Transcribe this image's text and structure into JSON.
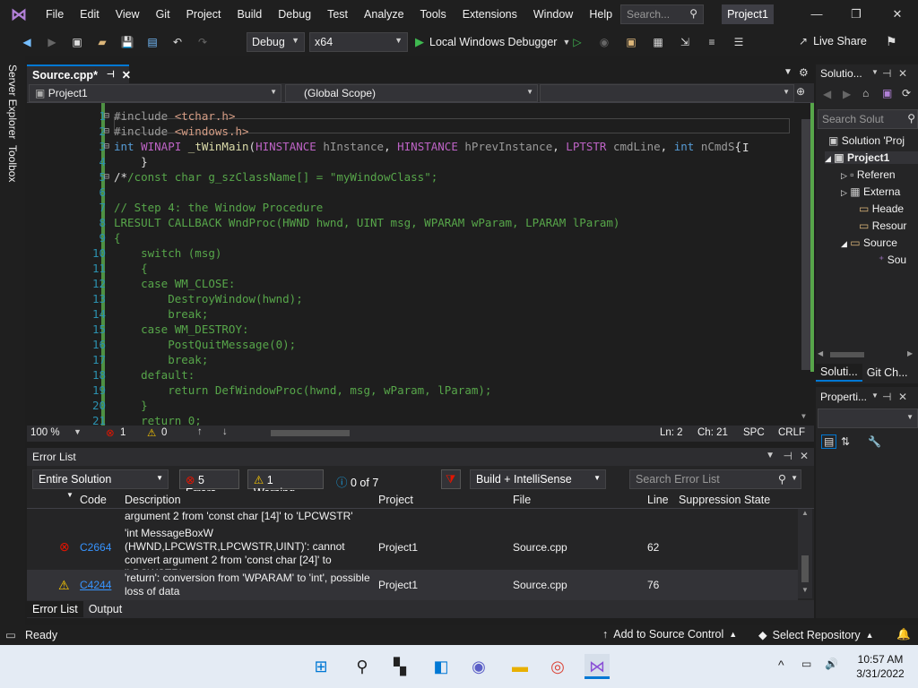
{
  "menu": {
    "items": [
      "File",
      "Edit",
      "View",
      "Git",
      "Project",
      "Build",
      "Debug",
      "Test",
      "Analyze",
      "Tools",
      "Extensions",
      "Window",
      "Help"
    ],
    "search_placeholder": "Search...",
    "project_name": "Project1"
  },
  "toolbar": {
    "config": "Debug",
    "platform": "x64",
    "run_label": "Local Windows Debugger",
    "live_share": "Live Share"
  },
  "side_tabs": {
    "server_explorer": "Server Explorer",
    "toolbox": "Toolbox"
  },
  "doc_tab": {
    "label": "Source.cpp*"
  },
  "nav": {
    "project": "Project1",
    "scope": "(Global Scope)"
  },
  "editor": {
    "line_numbers": [
      "1",
      "2",
      "3",
      "4",
      "5",
      "6",
      "7",
      "8",
      "9",
      "10",
      "11",
      "12",
      "13",
      "14",
      "15",
      "16",
      "17",
      "18",
      "19",
      "20",
      "21"
    ],
    "zoom": "100 %",
    "errors_count": "1",
    "warnings_count": "0",
    "ln": "Ln: 2",
    "ch": "Ch: 21",
    "spc": "SPC",
    "crlf": "CRLF"
  },
  "error_list": {
    "title": "Error List",
    "scope": "Entire Solution",
    "errors_btn": "5 Errors",
    "warnings_btn": "1 Warning",
    "messages_btn": "0 of 7 Messages",
    "build_filter": "Build + IntelliSense",
    "search_placeholder": "Search Error List",
    "columns": [
      "Code",
      "Description",
      "Project",
      "File",
      "Line",
      "Suppression State"
    ],
    "rows": [
      {
        "code": "",
        "desc": "argument 2 from 'const char [14]' to 'LPCWSTR'",
        "project": "",
        "file": "",
        "line": ""
      },
      {
        "code": "C2664",
        "desc": "'int MessageBoxW (HWND,LPCWSTR,LPCWSTR,UINT)': cannot convert argument 2 from 'const char [24]' to 'LPCWSTR'",
        "project": "Project1",
        "file": "Source.cpp",
        "line": "62"
      },
      {
        "code": "C4244",
        "desc": "'return': conversion from 'WPARAM' to 'int', possible loss of data",
        "project": "Project1",
        "file": "Source.cpp",
        "line": "76"
      }
    ],
    "tab_error_list": "Error List",
    "tab_output": "Output"
  },
  "solution_explorer": {
    "title": "Solutio...",
    "search": "Search Solut",
    "items": [
      "Solution 'Proj",
      "Project1",
      "Referen",
      "Externa",
      "Heade",
      "Resour",
      "Source",
      "Sou"
    ],
    "tab1": "Soluti...",
    "tab2": "Git Ch..."
  },
  "properties": {
    "title": "Properti..."
  },
  "status": {
    "ready": "Ready",
    "source_control": "Add to Source Control",
    "repository": "Select Repository"
  },
  "taskbar": {
    "time": "10:57 AM",
    "date": "3/31/2022"
  }
}
